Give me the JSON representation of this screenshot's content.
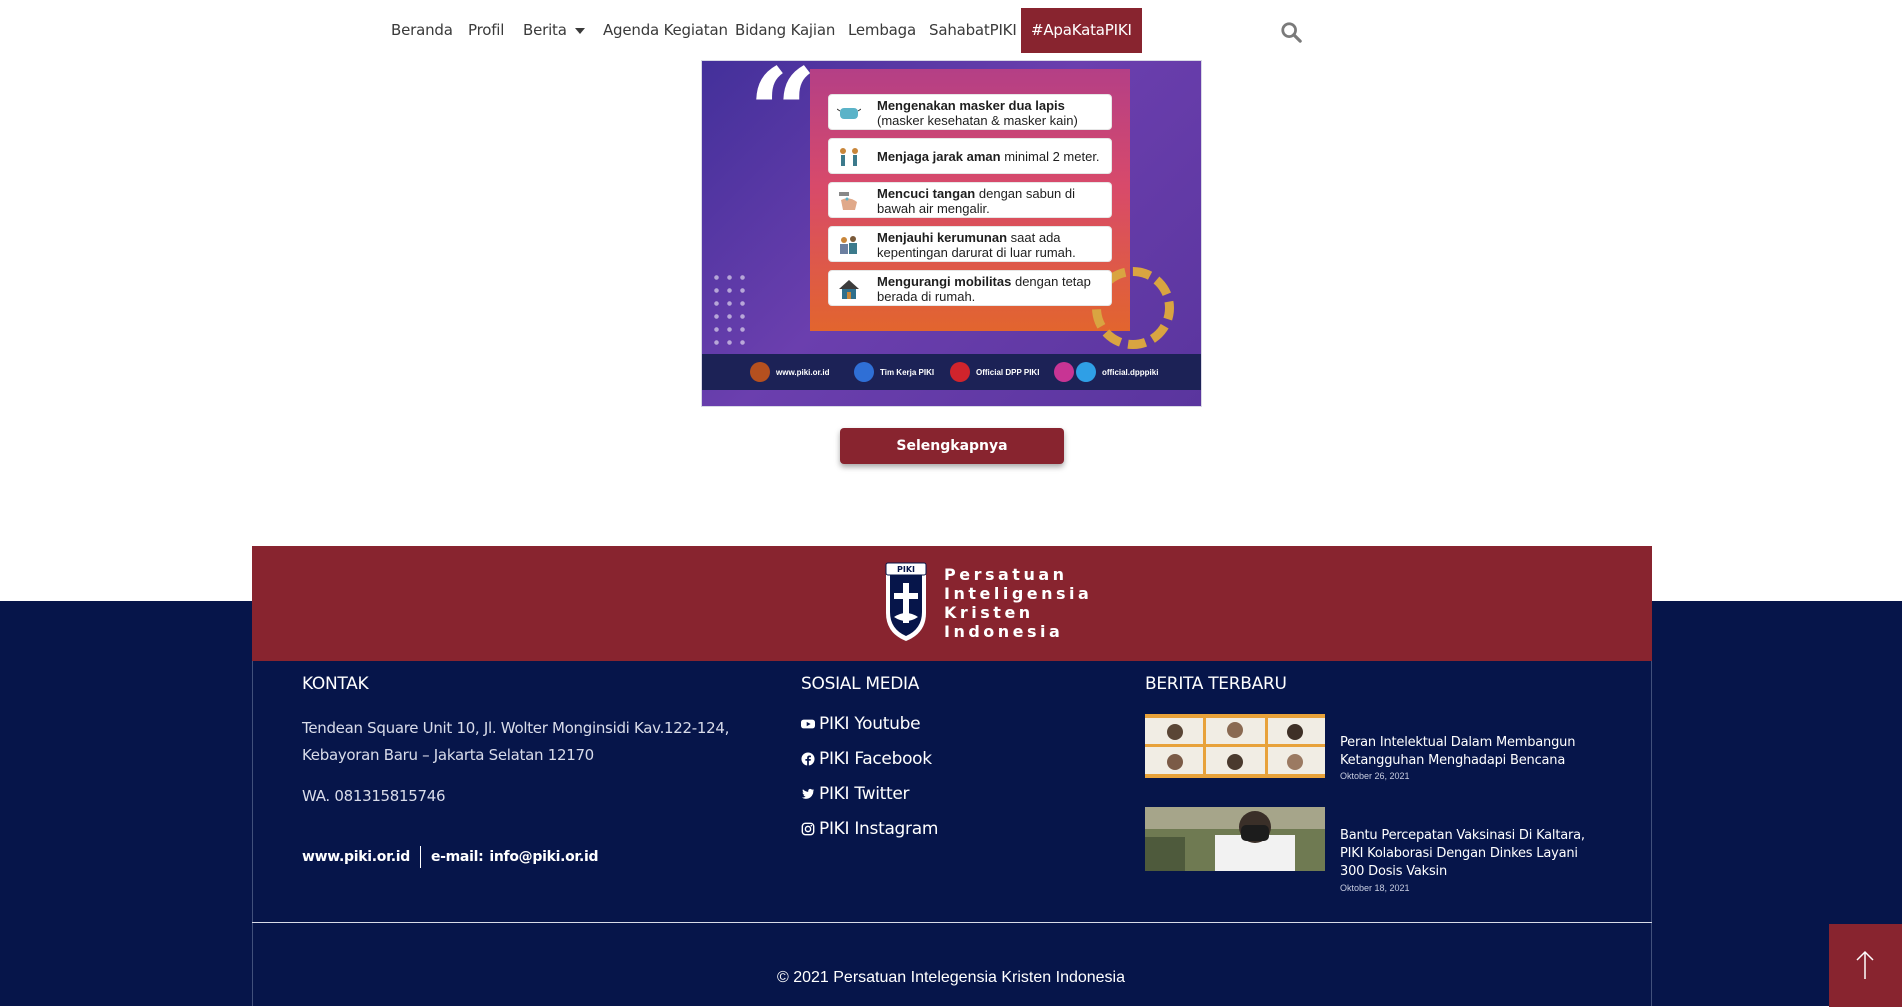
{
  "nav": {
    "items": [
      "Beranda",
      "Profil",
      "Berita",
      "Agenda Kegiatan",
      "Bidang Kajian",
      "Lembaga",
      "SahabatPIKI",
      "#ApaKataPIKI"
    ],
    "active": "#ApaKataPIKI",
    "search_icon": "search-icon"
  },
  "poster": {
    "tips": [
      {
        "bold": "Mengenakan masker dua lapis",
        "rest": "(masker kesehatan & masker kain)"
      },
      {
        "bold": "Menjaga jarak aman",
        "rest": "minimal 2 meter."
      },
      {
        "bold": "Mencuci tangan",
        "rest": "dengan sabun di bawah air mengalir."
      },
      {
        "bold": "Menjauhi kerumunan",
        "rest": "saat ada kepentingan darurat di luar rumah."
      },
      {
        "bold": "Mengurangi mobilitas",
        "rest": "dengan tetap berada di rumah."
      }
    ],
    "strip": [
      "www.piki.or.id",
      "Tim Kerja PIKI",
      "Official DPP PIKI",
      "official.dpppiki"
    ]
  },
  "more_button": "Selengkapnya",
  "footer": {
    "brand_lines": [
      "Persatuan",
      "Inteligensia",
      "Kristen",
      "Indonesia"
    ],
    "brand_badge": "PIKI",
    "contact": {
      "title": "KONTAK",
      "address_line1": "Tendean Square Unit 10, Jl. Wolter Monginsidi Kav.122-124,",
      "address_line2": "Kebayoran Baru – Jakarta Selatan 12170",
      "wa": "WA. 081315815746",
      "website": "www.piki.or.id",
      "email_label": "e-mail:",
      "email": "info@piki.or.id"
    },
    "social": {
      "title": "SOSIAL MEDIA",
      "items": [
        "PIKI Youtube",
        "PIKI Facebook",
        "PIKI Twitter",
        "PIKI Instagram"
      ]
    },
    "news": {
      "title": "BERITA TERBARU",
      "items": [
        {
          "title": "Peran Intelektual Dalam Membangun Ketangguhan Menghadapi Bencana",
          "date": "Oktober 26, 2021"
        },
        {
          "title": "Bantu Percepatan Vaksinasi Di Kaltara, PIKI Kolaborasi Dengan Dinkes Layani 300 Dosis Vaksin",
          "date": "Oktober 18, 2021"
        }
      ]
    },
    "copyright": "© 2021 Persatuan Intelegensia Kristen Indonesia"
  },
  "colors": {
    "brand_red": "#88242f",
    "navy": "#06154a"
  }
}
